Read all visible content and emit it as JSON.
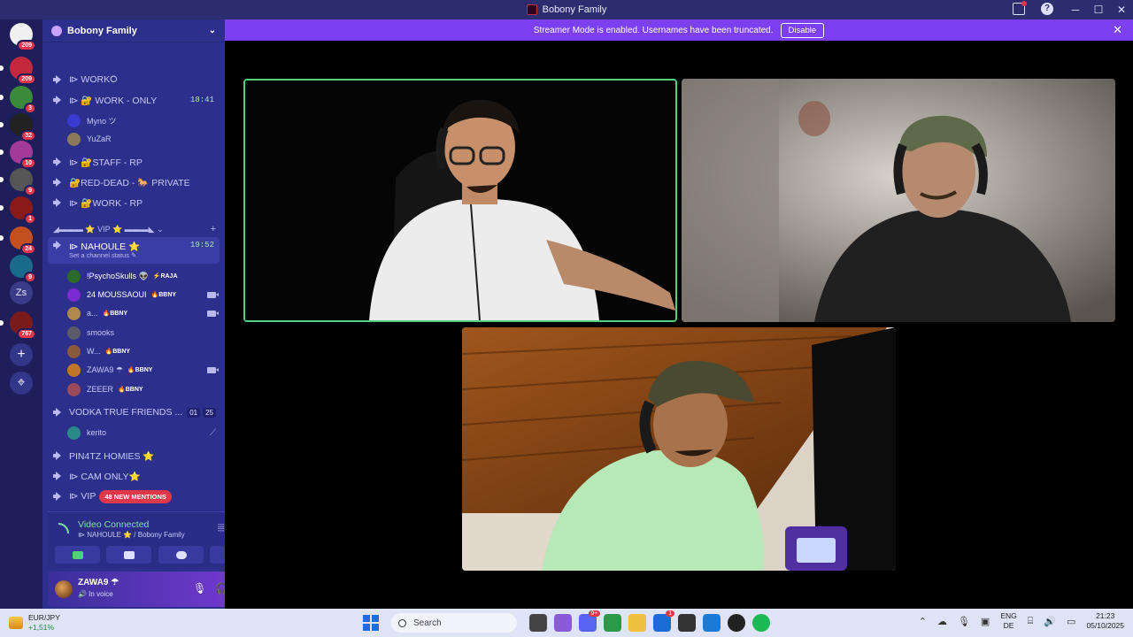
{
  "window": {
    "title": "Bobony Family"
  },
  "banner": {
    "text": "Streamer Mode is enabled. Usernames have been truncated.",
    "disable_label": "Disable",
    "close_glyph": "✕"
  },
  "servers": {
    "home_badge": "209",
    "items": [
      {
        "badge": "209",
        "color": "#c4283e"
      },
      {
        "badge": "3",
        "color": "#3a8a3a"
      },
      {
        "badge": "32",
        "color": "#222"
      },
      {
        "badge": "10",
        "color": "#a33a9a"
      },
      {
        "badge": "9",
        "color": "#555"
      },
      {
        "badge": "1",
        "color": "#8a1a1a"
      },
      {
        "badge": "24",
        "color": "#c45020"
      },
      {
        "badge": "9",
        "color": "#1a6a8a"
      }
    ],
    "zs_label": "Zs",
    "last_badge": "767",
    "add_glyph": "+",
    "explore_glyph": "⌖"
  },
  "guild": {
    "name": "Bobony Family"
  },
  "channels": {
    "work_o": "⧐ WORK⭘",
    "work_only": "⧐ 🔐 WORK - ONLY",
    "work_only_time": "18:41",
    "staff_rp": "⧐ 🔐STAFF - RP",
    "red_dead": "🔐RED-DEAD - 🐎 PRIVATE",
    "work_rp": "⧐ 🔐WORK - RP",
    "vip_category": "◢▬▬▬ ⭐ VIP ⭐ ▬▬▬◣ ⌄",
    "vip_plus": "+",
    "nahoule": "⧐ NAHOULE ⭐",
    "nahoule_time": "19:52",
    "nahoule_status": "Set a channel status ✎",
    "vodka": "VODKA TRUE FRIENDS ...",
    "vodka_counts": [
      "01",
      "25"
    ],
    "pin4tz": "PIN4TZ HOMIES ⭐",
    "cam_only": "⧐ CAM ONLY⭐",
    "vip": "⧐ VIP",
    "new_mentions": "48 NEW MENTIONS"
  },
  "users": {
    "work_only": [
      {
        "name": "Myno ツ",
        "color": "#3a3ad0"
      },
      {
        "name": "YuZaR",
        "color": "#8a7a5a"
      }
    ],
    "nahoule": [
      {
        "name": "!PsychoSkulls 👽",
        "tag": "⚡RAJA",
        "color": "#2a6a2a",
        "cam": false
      },
      {
        "name": "24 MOUSSAOUI",
        "tag": "🔥BBNY",
        "color": "#7a2ad0",
        "cam": true
      },
      {
        "name": "a...",
        "tag": "🔥BBNY",
        "color": "#b08a4a",
        "cam": true
      },
      {
        "name": "smooks",
        "tag": "",
        "color": "#5a5a6a",
        "cam": false
      },
      {
        "name": "W...",
        "tag": "🔥BBNY",
        "color": "#8a5a3a",
        "cam": false
      },
      {
        "name": "ZAWA9 ☂",
        "tag": "🔥BBNY",
        "color": "#c2762a",
        "cam": true
      },
      {
        "name": "ZEEER",
        "tag": "🔥BBNY",
        "color": "#9a4a5a",
        "cam": false
      }
    ],
    "vodka": [
      {
        "name": "kerito",
        "color": "#2a8a8a",
        "mute_glyph": "⟋"
      }
    ]
  },
  "voice": {
    "title": "Video Connected",
    "subtitle": "⧐ NAHOULE ⭐ / Bobony Family",
    "wave_glyph": "⦙⦙⦙",
    "hangup_glyph": "☎"
  },
  "me": {
    "name": "ZAWA9 ☂",
    "status": "🔊 In voice",
    "mic_glyph": "🎙",
    "headset_glyph": "🎧",
    "settings_glyph": "⚙"
  },
  "taskbar": {
    "ticker_name": "EUR/JPY",
    "ticker_change": "+1,51%",
    "search_placeholder": "Search",
    "apps": [
      {
        "name": "taskview",
        "color": "#444",
        "n": ""
      },
      {
        "name": "copilot",
        "color": "#8a5ad8",
        "n": ""
      },
      {
        "name": "discord",
        "color": "#5865f2",
        "n": "9+"
      },
      {
        "name": "chrome",
        "color": "#2a9a4a",
        "n": ""
      },
      {
        "name": "explorer",
        "color": "#f0c040",
        "n": ""
      },
      {
        "name": "store",
        "color": "#1a6ad8",
        "n": "1"
      },
      {
        "name": "unity",
        "color": "#333",
        "n": ""
      },
      {
        "name": "vscode",
        "color": "#1a7ad8",
        "n": ""
      },
      {
        "name": "obs",
        "color": "#222",
        "n": ""
      },
      {
        "name": "spotify",
        "color": "#1db954",
        "n": ""
      }
    ],
    "lang_top": "ENG",
    "lang_bottom": "DE",
    "time": "21:23",
    "date": "05/10/2025"
  }
}
